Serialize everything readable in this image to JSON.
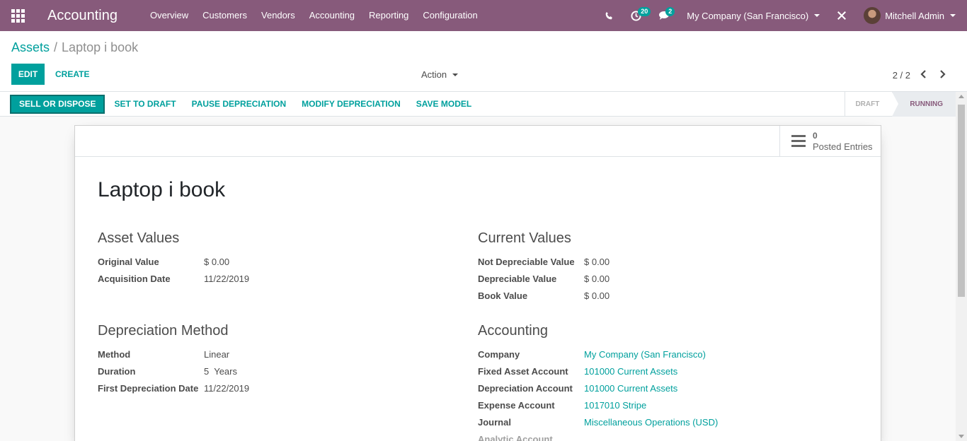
{
  "navbar": {
    "app_name": "Accounting",
    "menu": [
      "Overview",
      "Customers",
      "Vendors",
      "Accounting",
      "Reporting",
      "Configuration"
    ],
    "activity_count": "20",
    "message_count": "2",
    "company": "My Company (San Francisco)",
    "user": "Mitchell Admin"
  },
  "breadcrumb": {
    "parent": "Assets",
    "current": "Laptop i book"
  },
  "buttons": {
    "edit": "EDIT",
    "create": "CREATE",
    "action": "Action"
  },
  "pager": {
    "value": "2 / 2"
  },
  "statusbar": {
    "buttons": [
      "SELL OR DISPOSE",
      "SET TO DRAFT",
      "PAUSE DEPRECIATION",
      "MODIFY DEPRECIATION",
      "SAVE MODEL"
    ],
    "stages": [
      "DRAFT",
      "RUNNING"
    ],
    "active_stage": "RUNNING"
  },
  "stat_button": {
    "count": "0",
    "label": "Posted Entries"
  },
  "record": {
    "title": "Laptop i book",
    "asset_values": {
      "heading": "Asset Values",
      "original_value_label": "Original Value",
      "original_value": "$ 0.00",
      "acquisition_date_label": "Acquisition Date",
      "acquisition_date": "11/22/2019"
    },
    "current_values": {
      "heading": "Current Values",
      "not_depreciable_label": "Not Depreciable Value",
      "not_depreciable": "$ 0.00",
      "depreciable_label": "Depreciable Value",
      "depreciable": "$ 0.00",
      "book_value_label": "Book Value",
      "book_value": "$ 0.00"
    },
    "depreciation_method": {
      "heading": "Depreciation Method",
      "method_label": "Method",
      "method": "Linear",
      "duration_label": "Duration",
      "duration": "5  Years",
      "first_date_label": "First Depreciation Date",
      "first_date": "11/22/2019"
    },
    "accounting": {
      "heading": "Accounting",
      "company_label": "Company",
      "company": "My Company (San Francisco)",
      "fixed_asset_label": "Fixed Asset Account",
      "fixed_asset": "101000 Current Assets",
      "depreciation_account_label": "Depreciation Account",
      "depreciation_account": "101000 Current Assets",
      "expense_account_label": "Expense Account",
      "expense_account": "1017010 Stripe",
      "journal_label": "Journal",
      "journal": "Miscellaneous Operations (USD)",
      "analytic_label": "Analytic Account"
    }
  },
  "colors": {
    "navbar": "#875A7B",
    "accent": "#00A09D"
  },
  "icons": [
    "apps-grid-icon",
    "phone-icon",
    "activity-clock-icon",
    "chat-bubble-icon",
    "debug-tools-icon",
    "hamburger-icon",
    "chevron-left-icon",
    "chevron-right-icon",
    "caret-down-icon"
  ]
}
